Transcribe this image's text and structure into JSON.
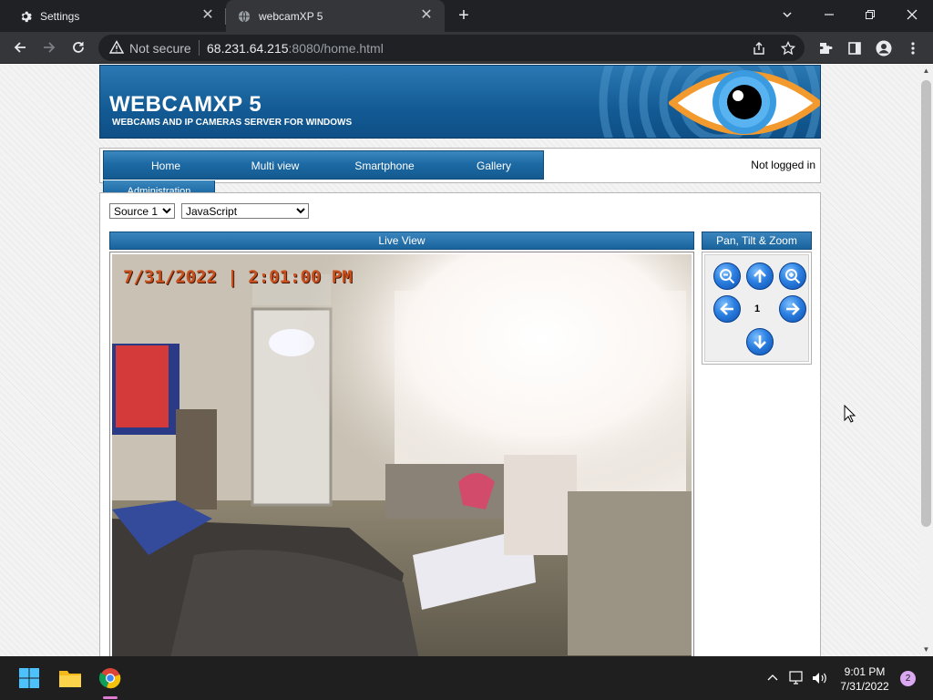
{
  "browser": {
    "tabs": [
      {
        "title": "Settings",
        "icon": "gear-icon",
        "active": false
      },
      {
        "title": "webcamXP 5",
        "icon": "globe-icon",
        "active": true
      }
    ],
    "address": {
      "security_label": "Not secure",
      "url_host": "68.231.64.215",
      "url_rest": ":8080/home.html"
    }
  },
  "page": {
    "banner": {
      "title": "WEBCAMXP 5",
      "subtitle": "WEBCAMS AND IP CAMERAS SERVER FOR WINDOWS"
    },
    "nav": {
      "items": [
        "Home",
        "Multi view",
        "Smartphone",
        "Gallery"
      ],
      "admin_label": "Administration",
      "login_status": "Not logged in"
    },
    "controls": {
      "source_options": [
        "Source 1"
      ],
      "source_value": "Source 1",
      "mode_options": [
        "JavaScript"
      ],
      "mode_value": "JavaScript"
    },
    "live_view": {
      "title": "Live View",
      "timestamp": "7/31/2022 | 2:01:00 PM"
    },
    "ptz": {
      "title": "Pan, Tilt & Zoom",
      "preset_number": "1"
    }
  },
  "taskbar": {
    "time": "9:01 PM",
    "date": "7/31/2022",
    "notification_count": "2"
  },
  "colors": {
    "banner_blue": "#135b95",
    "nav_blue": "#1d6aa5",
    "timestamp_orange": "#c84f1e"
  }
}
